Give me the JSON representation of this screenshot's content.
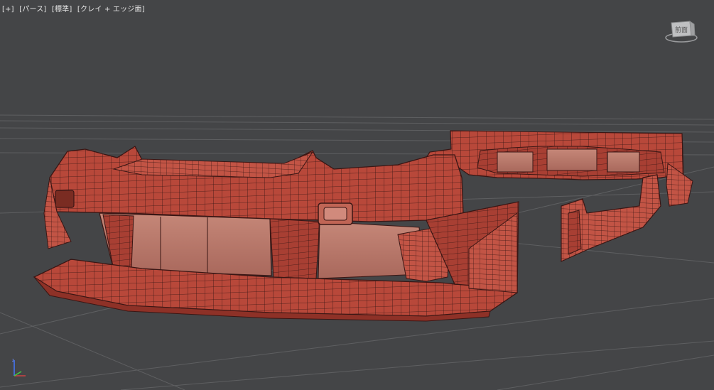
{
  "viewport": {
    "menu_plus": "[+]",
    "view_mode": "[パース]",
    "shading_mode": "[標準]",
    "display_mode": "[クレイ + エッジ面]"
  },
  "viewcube": {
    "face_label": "前面",
    "icon": "viewcube-icon"
  },
  "axis_gizmo": {
    "icon": "axis-tripod-icon"
  },
  "colors": {
    "background": "#444547",
    "grid": "#5a5b5d",
    "clay": "#b54a3c",
    "clay_light": "#c85b4b",
    "clay_inner": "#b8786c",
    "edge": "#3a1614",
    "axis_x": "#c44",
    "axis_y": "#4c4",
    "axis_z": "#47f"
  }
}
